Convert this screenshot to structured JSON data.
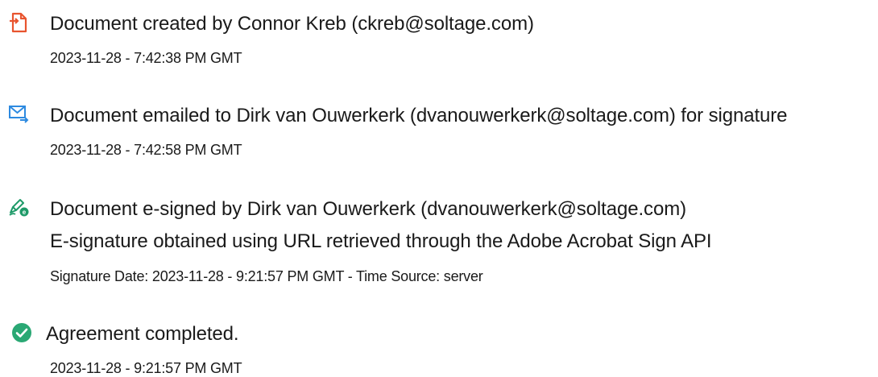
{
  "colors": {
    "created_icon": "#e8542f",
    "emailed_icon": "#2d8ae0",
    "signed_icon": "#1e9a68",
    "completed_icon": "#2aa874",
    "text": "#1a1a1a"
  },
  "events": [
    {
      "icon": "document-icon",
      "title": "Document created by Connor Kreb (ckreb@soltage.com)",
      "timestamp": "2023-11-28 - 7:42:38 PM GMT"
    },
    {
      "icon": "email-icon",
      "title": "Document emailed to Dirk van Ouwerkerk (dvanouwerkerk@soltage.com) for signature",
      "timestamp": "2023-11-28 - 7:42:58 PM GMT"
    },
    {
      "icon": "e-sign-pen-icon",
      "title": "Document e-signed by Dirk van Ouwerkerk (dvanouwerkerk@soltage.com)",
      "detail": "E-signature obtained using URL retrieved through the Adobe Acrobat Sign API",
      "timestamp": "Signature Date: 2023-11-28 - 9:21:57 PM GMT - Time Source: server"
    },
    {
      "icon": "check-circle-icon",
      "title": "Agreement completed.",
      "timestamp": "2023-11-28 - 9:21:57 PM GMT"
    }
  ]
}
